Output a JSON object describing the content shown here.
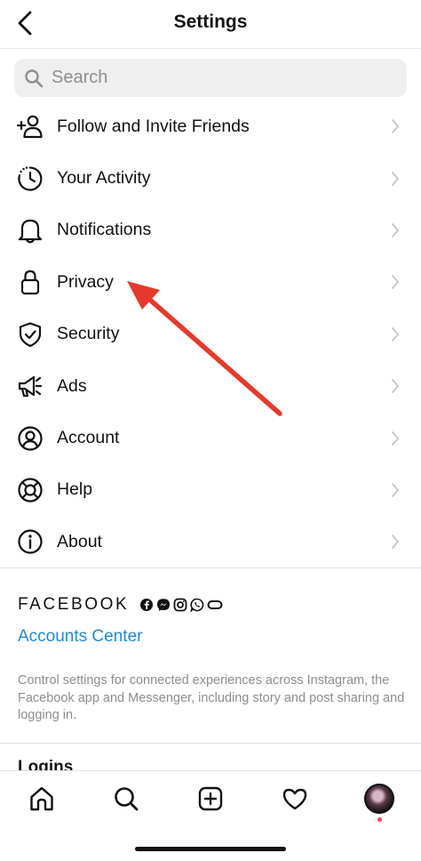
{
  "header": {
    "title": "Settings"
  },
  "search": {
    "placeholder": "Search"
  },
  "menu": [
    {
      "label": "Follow and Invite Friends",
      "icon": "add-person-icon"
    },
    {
      "label": "Your Activity",
      "icon": "activity-clock-icon"
    },
    {
      "label": "Notifications",
      "icon": "bell-icon"
    },
    {
      "label": "Privacy",
      "icon": "lock-icon"
    },
    {
      "label": "Security",
      "icon": "shield-check-icon"
    },
    {
      "label": "Ads",
      "icon": "megaphone-icon"
    },
    {
      "label": "Account",
      "icon": "account-circle-icon"
    },
    {
      "label": "Help",
      "icon": "lifebuoy-icon"
    },
    {
      "label": "About",
      "icon": "info-icon"
    }
  ],
  "facebook": {
    "wordmark": "FACEBOOK",
    "accounts_center": "Accounts Center",
    "description": "Control settings for connected experiences across Instagram, the Facebook app and Messenger, including story and post sharing and logging in."
  },
  "logins": {
    "label": "Logins"
  },
  "annotation": {
    "color": "#e8382b",
    "points_to": "Privacy"
  },
  "colors": {
    "link": "#1a8cd8",
    "notification_dot": "#ed4956"
  }
}
